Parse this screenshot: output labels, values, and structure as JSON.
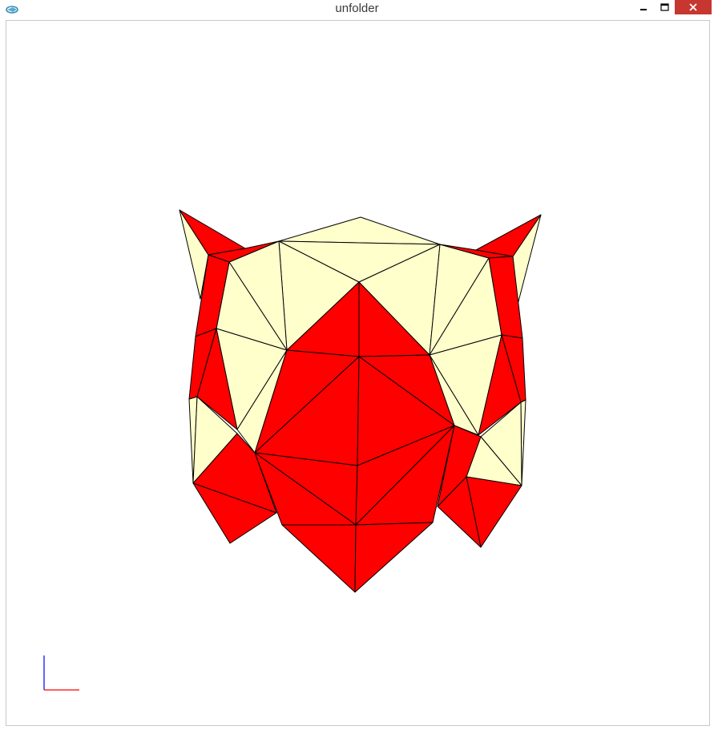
{
  "window": {
    "title": "unfolder",
    "icon": "app-logo-icon",
    "controls": [
      "minimize-icon",
      "maximize-icon",
      "close-icon"
    ]
  },
  "viewport": {
    "background": "#ffffff",
    "model_colors": {
      "outside": "#ff0000",
      "inside": "#ffffcc",
      "edges": "#000000"
    },
    "axes_gizmo": {
      "x_color": "#ff0000",
      "y_color": "#0000ff"
    }
  }
}
